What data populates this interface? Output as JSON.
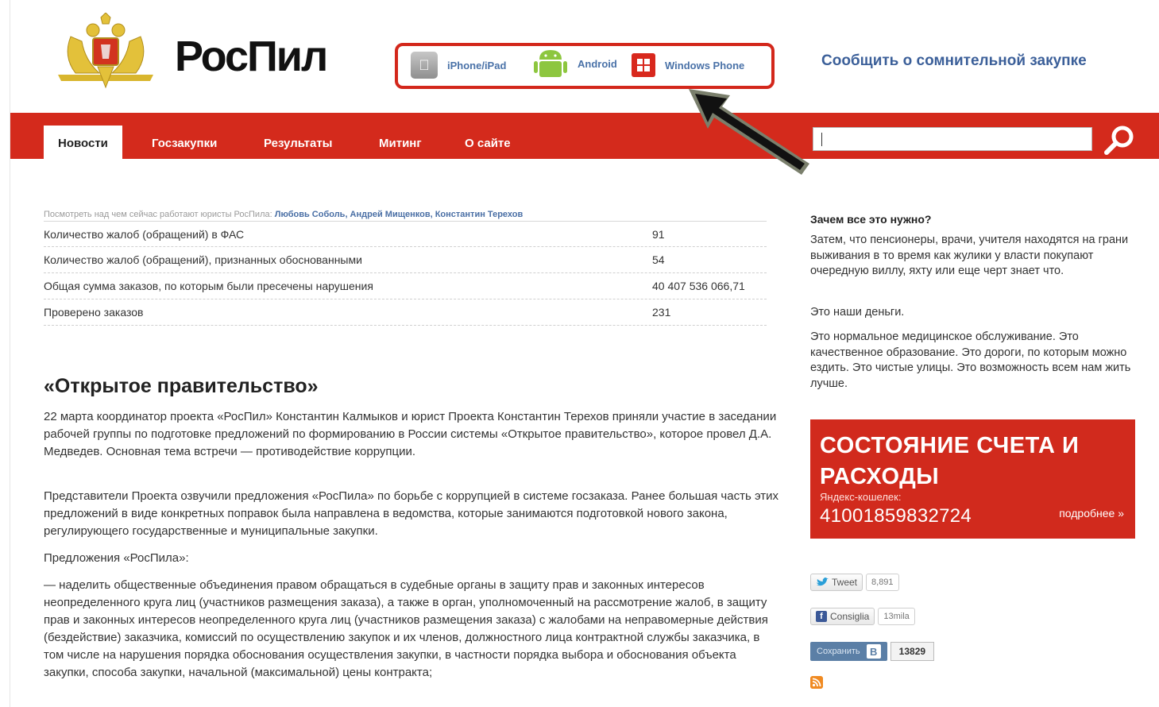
{
  "header": {
    "logo_text": "РосПил",
    "apps": {
      "iphone": "iPhone/iPad",
      "android": "Android",
      "windows": "Windows Phone"
    },
    "report_link": "Сообщить о сомнительной закупке"
  },
  "nav": {
    "items": [
      "Новости",
      "Госзакупки",
      "Результаты",
      "Митинг",
      "О сайте"
    ],
    "active": "Новости",
    "search_value": ""
  },
  "stats": {
    "caption_prefix": "Посмотреть над чем сейчас работают юристы РосПила:",
    "lawyers": "Любовь Соболь, Андрей Мищенков, Константин Терехов",
    "rows": [
      {
        "label": "Количество жалоб (обращений) в ФАС",
        "value": "91"
      },
      {
        "label": "Количество жалоб (обращений), признанных обоснованными",
        "value": "54"
      },
      {
        "label": "Общая сумма заказов, по которым были пресечены нарушения",
        "value": "40 407 536 066,71"
      },
      {
        "label": "Проверено заказов",
        "value": "231"
      }
    ]
  },
  "article": {
    "title": "«Открытое правительство»",
    "p1": "22 марта координатор проекта «РосПил» Константин Калмыков и юрист Проекта Константин Терехов приняли участие в заседании рабочей группы по подготовке предложений по формированию в России системы «Открытое правительство», которое провел Д.А. Медведев. Основная тема встречи — противодействие коррупции.",
    "p2": "Представители Проекта озвучили предложения «РосПила» по борьбе с коррупцией в системе госзаказа. Ранее большая часть этих предложений в виде конкретных поправок была направлена в ведомства, которые занимаются подготовкой нового закона, регулирующего государственные и муниципальные закупки.",
    "p3": "Предложения «РосПила»:",
    "p4": "— наделить общественные объединения правом обращаться в судебные органы в защиту прав и законных интересов неопределенного круга лиц (участников размещения заказа), а также в орган, уполномоченный на рассмотрение жалоб, в защиту прав и законных интересов неопределенного круга лиц (участников размещения заказа) с жалобами на неправомерные действия (бездействие) заказчика, комиссий по осуществлению закупок и их членов, должностного лица контрактной службы заказчика, в том числе на нарушения порядка обоснования осуществления закупки, в частности порядка выбора и обоснования объекта закупки, способа закупки, начальной (максимальной) цены контракта;"
  },
  "sidebar": {
    "heading": "Зачем все это нужно?",
    "t1": "Затем, что пенсионеры, врачи, учителя находятся на грани выживания в то время как жулики у власти покупают очередную виллу, яхту или еще черт знает что.",
    "t2": "Это наши деньги.",
    "t3": "Это нормальное медицинское обслуживание. Это качественное образование. Это дороги, по которым можно ездить. Это чистые улицы. Это возможность всем нам жить лучше.",
    "account": {
      "title": "СОСТОЯНИЕ СЧЕТА И РАСХОДЫ",
      "sub": "Яндекс-кошелек:",
      "number": "41001859832724",
      "more": "подробнее »"
    },
    "social": {
      "tweet_label": "Tweet",
      "tweet_count": "8,891",
      "fb_label": "Consiglia",
      "fb_count": "13mila",
      "vk_label": "Сохранить",
      "vk_letter": "В",
      "vk_count": "13829"
    }
  },
  "colors": {
    "brand_red": "#d42a1c",
    "link_blue": "#3b5f99"
  },
  "icons": [
    "emblem-icon",
    "apple-icon",
    "android-icon",
    "windows-icon",
    "search-icon",
    "arrow-icon",
    "twitter-icon",
    "facebook-icon",
    "rss-icon"
  ]
}
